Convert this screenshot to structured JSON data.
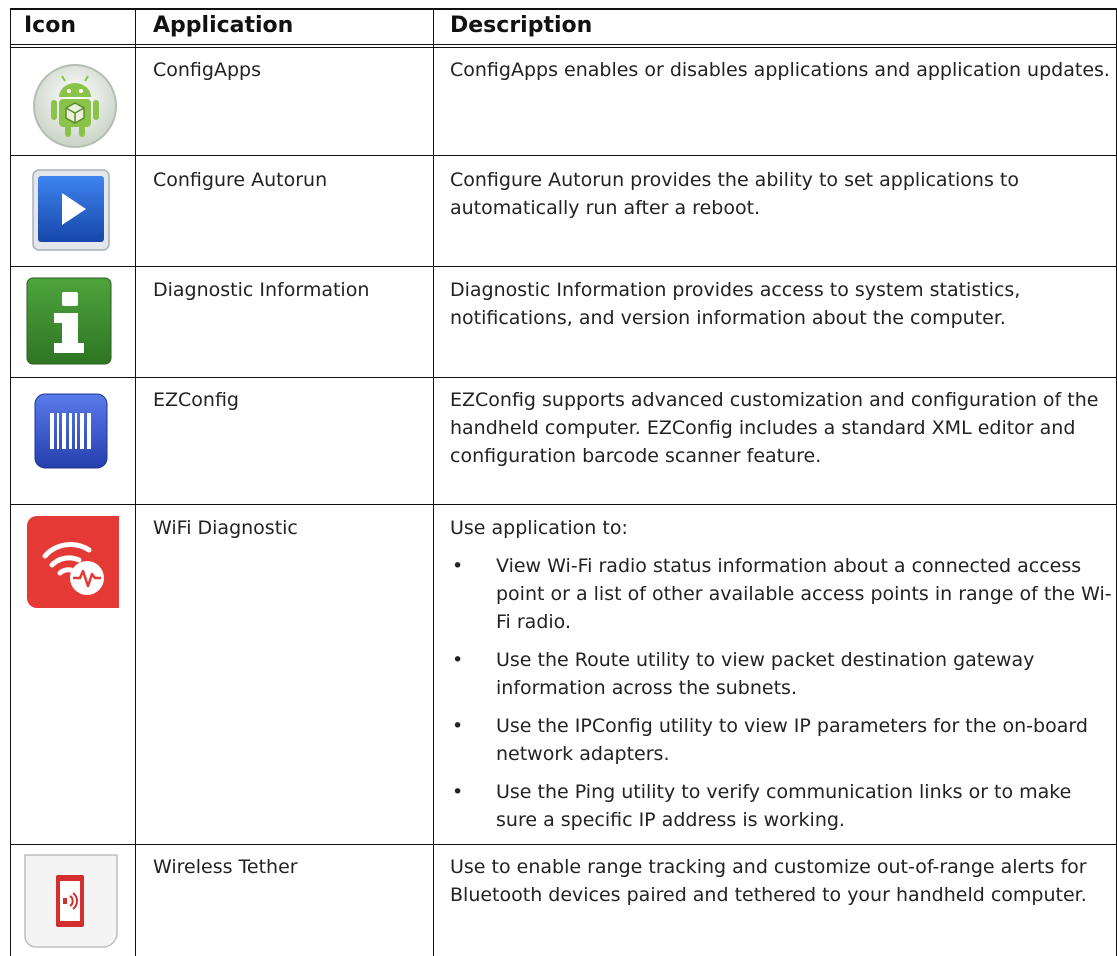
{
  "headers": {
    "icon": "Icon",
    "application": "Application",
    "description": "Description"
  },
  "rows": [
    {
      "icon": "android-configapps-icon",
      "name": "ConfigApps",
      "description": "ConfigApps enables or disables applications and application updates."
    },
    {
      "icon": "play-autorun-icon",
      "name": "Configure Autorun",
      "description": "Configure Autorun provides the ability to set applications to automatically run after a reboot."
    },
    {
      "icon": "info-icon",
      "name": "Diagnostic Information",
      "description": "Diagnostic Information provides access to system statistics, notifications, and version information about the computer."
    },
    {
      "icon": "barcode-ezconfig-icon",
      "name": "EZConfig",
      "description": "EZConfig supports advanced customization and configuration of the handheld computer. EZConfig includes a standard XML editor and configuration barcode scanner feature."
    },
    {
      "icon": "wifi-diagnostic-icon",
      "name": "WiFi Diagnostic",
      "description": "Use application to:",
      "bullets": [
        "View Wi-Fi radio status information about a connected access point or a list of other available access points in range of the Wi-Fi radio.",
        "Use the Route utility to view packet destination gateway information across the subnets.",
        "Use the IPConfig utility to view IP parameters for the on-board network adapters.",
        "Use the Ping utility to verify communication links or to make sure a specific IP address is working."
      ]
    },
    {
      "icon": "wireless-tether-icon",
      "name": "Wireless Tether",
      "description": "Use to enable range tracking and customize out-of-range alerts for Bluetooth devices paired and tethered to your handheld computer."
    }
  ],
  "bullet_symbol": "•",
  "colors": {
    "android_green": "#8bc34a",
    "autorun_blue": "#1e5bc6",
    "info_green": "#3d8b2f",
    "ezconfig_blue": "#3552c6",
    "wifi_red": "#e53935",
    "tether_red": "#d32f2f"
  }
}
